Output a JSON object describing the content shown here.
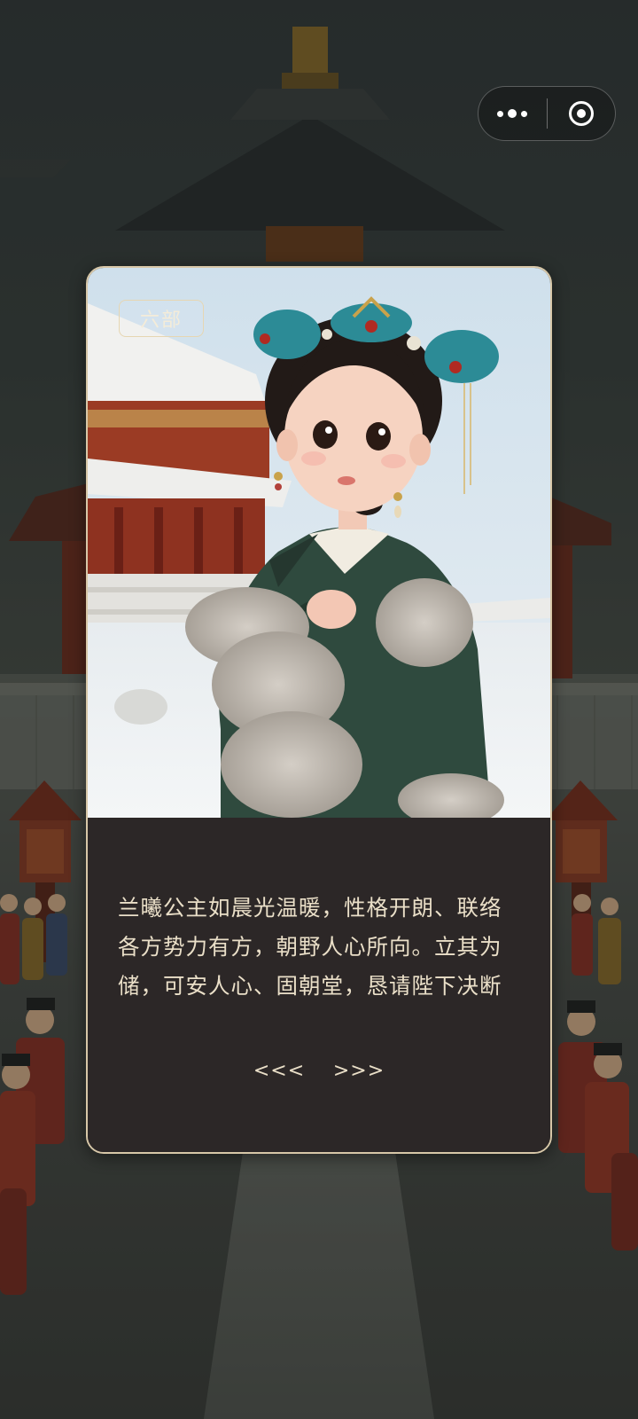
{
  "capsule": {
    "more_icon": "more-dots-icon",
    "close_icon": "target-circle-icon"
  },
  "card": {
    "department_tag": "六部",
    "story_lines": [
      "兰曦公主如晨光温暖，性格开朗、联络",
      "各方势力有方，朝野人心所向。立其为",
      "储，可安人心、固朝堂，恳请陛下决断"
    ],
    "prev_label": "<<<",
    "next_label": ">>>"
  },
  "colors": {
    "card_border": "#d7c7a8",
    "card_text_bg": "#2c2727",
    "text": "#eadfc8",
    "robe_green": "#2f4a3e"
  }
}
